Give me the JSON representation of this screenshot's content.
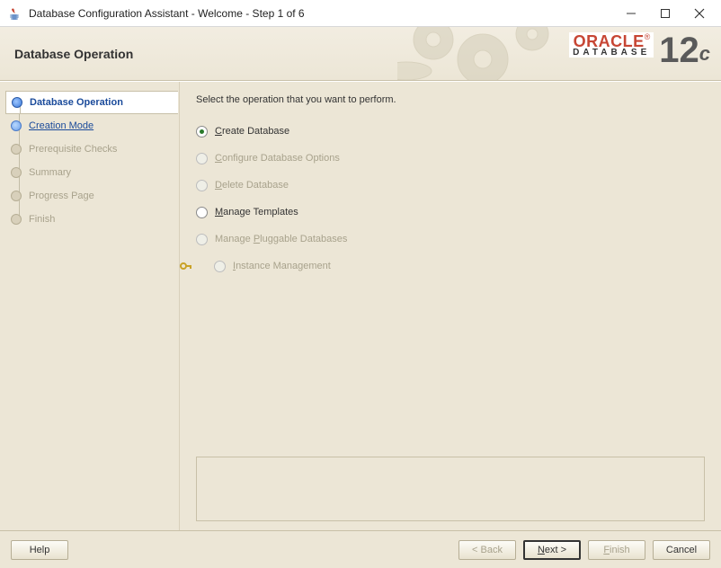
{
  "window": {
    "title": "Database Configuration Assistant - Welcome - Step 1 of 6"
  },
  "header": {
    "title": "Database Operation",
    "brand_name": "ORACLE",
    "brand_sub": "DATABASE",
    "brand_version_num": "12",
    "brand_version_suffix": "c"
  },
  "steps": [
    {
      "label": "Database Operation",
      "state": "current"
    },
    {
      "label": "Creation Mode",
      "state": "link"
    },
    {
      "label": "Prerequisite Checks",
      "state": "disabled"
    },
    {
      "label": "Summary",
      "state": "disabled"
    },
    {
      "label": "Progress Page",
      "state": "disabled"
    },
    {
      "label": "Finish",
      "state": "disabled"
    }
  ],
  "content": {
    "instruction": "Select the operation that you want to perform.",
    "options": [
      {
        "pre": "",
        "mnemonic": "C",
        "rest": "reate Database",
        "enabled": true,
        "selected": true,
        "key": false
      },
      {
        "pre": "",
        "mnemonic": "C",
        "rest": "onfigure Database Options",
        "enabled": false,
        "selected": false,
        "key": false
      },
      {
        "pre": "",
        "mnemonic": "D",
        "rest": "elete Database",
        "enabled": false,
        "selected": false,
        "key": false
      },
      {
        "pre": "",
        "mnemonic": "M",
        "rest": "anage Templates",
        "enabled": true,
        "selected": false,
        "key": false
      },
      {
        "pre": "Manage ",
        "mnemonic": "P",
        "rest": "luggable Databases",
        "enabled": false,
        "selected": false,
        "key": false
      },
      {
        "pre": "",
        "mnemonic": "I",
        "rest": "nstance Management",
        "enabled": false,
        "selected": false,
        "key": true
      }
    ]
  },
  "footer": {
    "help": "Help",
    "back": "< Back",
    "next_pre": "",
    "next_mn": "N",
    "next_rest": "ext >",
    "finish": "Finish",
    "cancel": "Cancel"
  }
}
